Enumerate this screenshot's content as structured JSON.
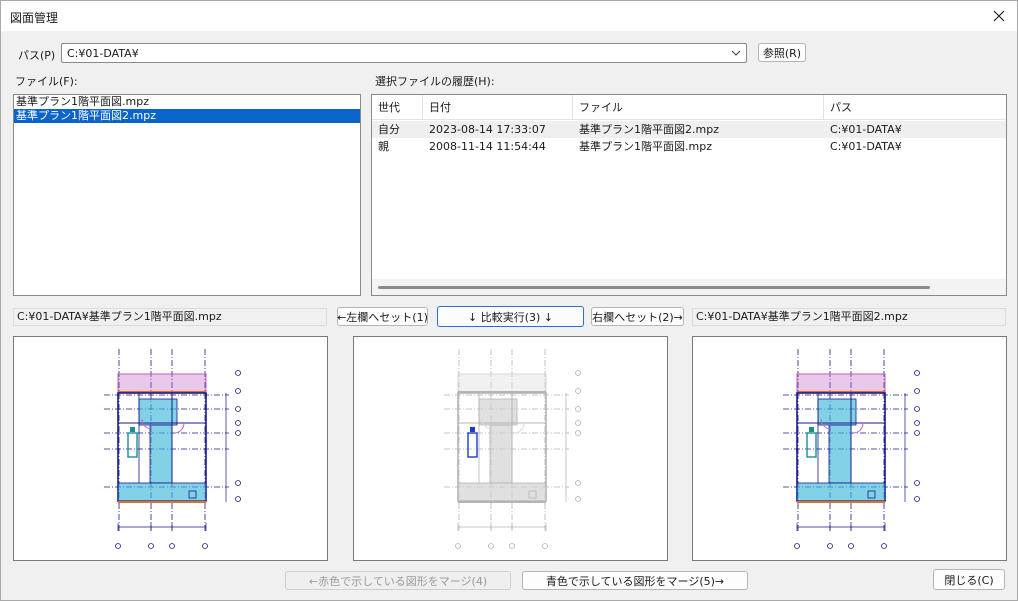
{
  "window": {
    "title": "図面管理"
  },
  "path": {
    "label": "パス(P)",
    "value": "C:¥01-DATA¥",
    "browse_label": "参照(R)"
  },
  "files": {
    "label": "ファイル(F):",
    "items": [
      {
        "name": "基準プラン1階平面図.mpz",
        "selected": false
      },
      {
        "name": "基準プラン1階平面図2.mpz",
        "selected": true
      }
    ]
  },
  "history": {
    "label": "選択ファイルの履歴(H):",
    "columns": [
      "世代",
      "日付",
      "ファイル",
      "パス"
    ],
    "rows": [
      {
        "generation": "自分",
        "date": "2023-08-14 17:33:07",
        "file": "基準プラン1階平面図2.mpz",
        "path": "C:¥01-DATA¥"
      },
      {
        "generation": "親",
        "date": "2008-11-14 11:54:44",
        "file": "基準プラン1階平面図.mpz",
        "path": "C:¥01-DATA¥"
      }
    ]
  },
  "compare": {
    "left_path": "C:¥01-DATA¥基準プラン1階平面図.mpz",
    "right_path": "C:¥01-DATA¥基準プラン1階平面図2.mpz",
    "set_left_label": "←左欄へセット(1)",
    "run_label": "↓  比較実行(3)  ↓",
    "set_right_label": "右欄へセット(2)→"
  },
  "footer": {
    "merge_red_label": "←赤色で示している図形をマージ(4)",
    "merge_blue_label": "青色で示している図形をマージ(5)→",
    "close_label": "閉じる(C)"
  },
  "colors": {
    "accent": "#0b64c9",
    "plan_cyan": "#3fb8d8",
    "plan_pink": "#c060c0",
    "plan_navy": "#1a1a8c",
    "plan_orange": "#e07020",
    "plan_teal": "#1a9090"
  }
}
